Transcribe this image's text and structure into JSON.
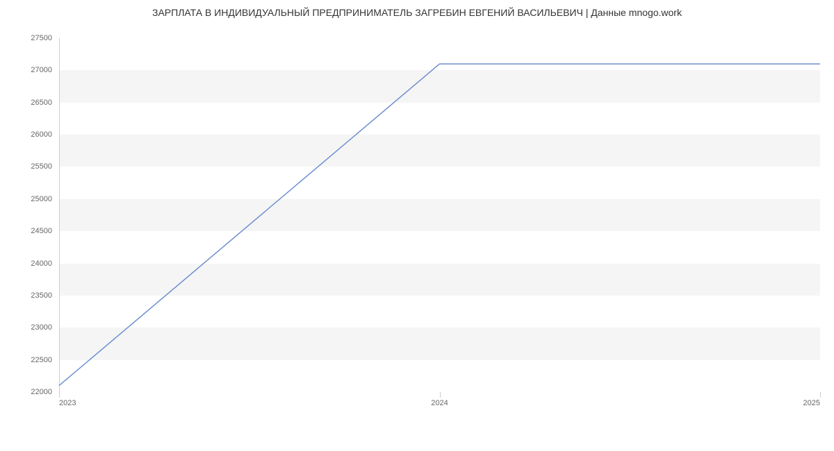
{
  "chart_data": {
    "type": "line",
    "title": "ЗАРПЛАТА В ИНДИВИДУАЛЬНЫЙ ПРЕДПРИНИМАТЕЛЬ ЗАГРЕБИН ЕВГЕНИЙ ВАСИЛЬЕВИЧ | Данные mnogo.work",
    "x": [
      2023,
      2024,
      2025
    ],
    "series": [
      {
        "name": "Зарплата",
        "values": [
          22100,
          27100,
          27100
        ],
        "color": "#6e8fd0"
      }
    ],
    "x_ticks": [
      2023,
      2024,
      2025
    ],
    "y_ticks": [
      22000,
      22500,
      23000,
      23500,
      24000,
      24500,
      25000,
      25500,
      26000,
      26500,
      27000,
      27500
    ],
    "xlim": [
      2023,
      2025
    ],
    "ylim": [
      22000,
      27500
    ],
    "xlabel": "",
    "ylabel": "",
    "grid": true,
    "legend": false
  }
}
